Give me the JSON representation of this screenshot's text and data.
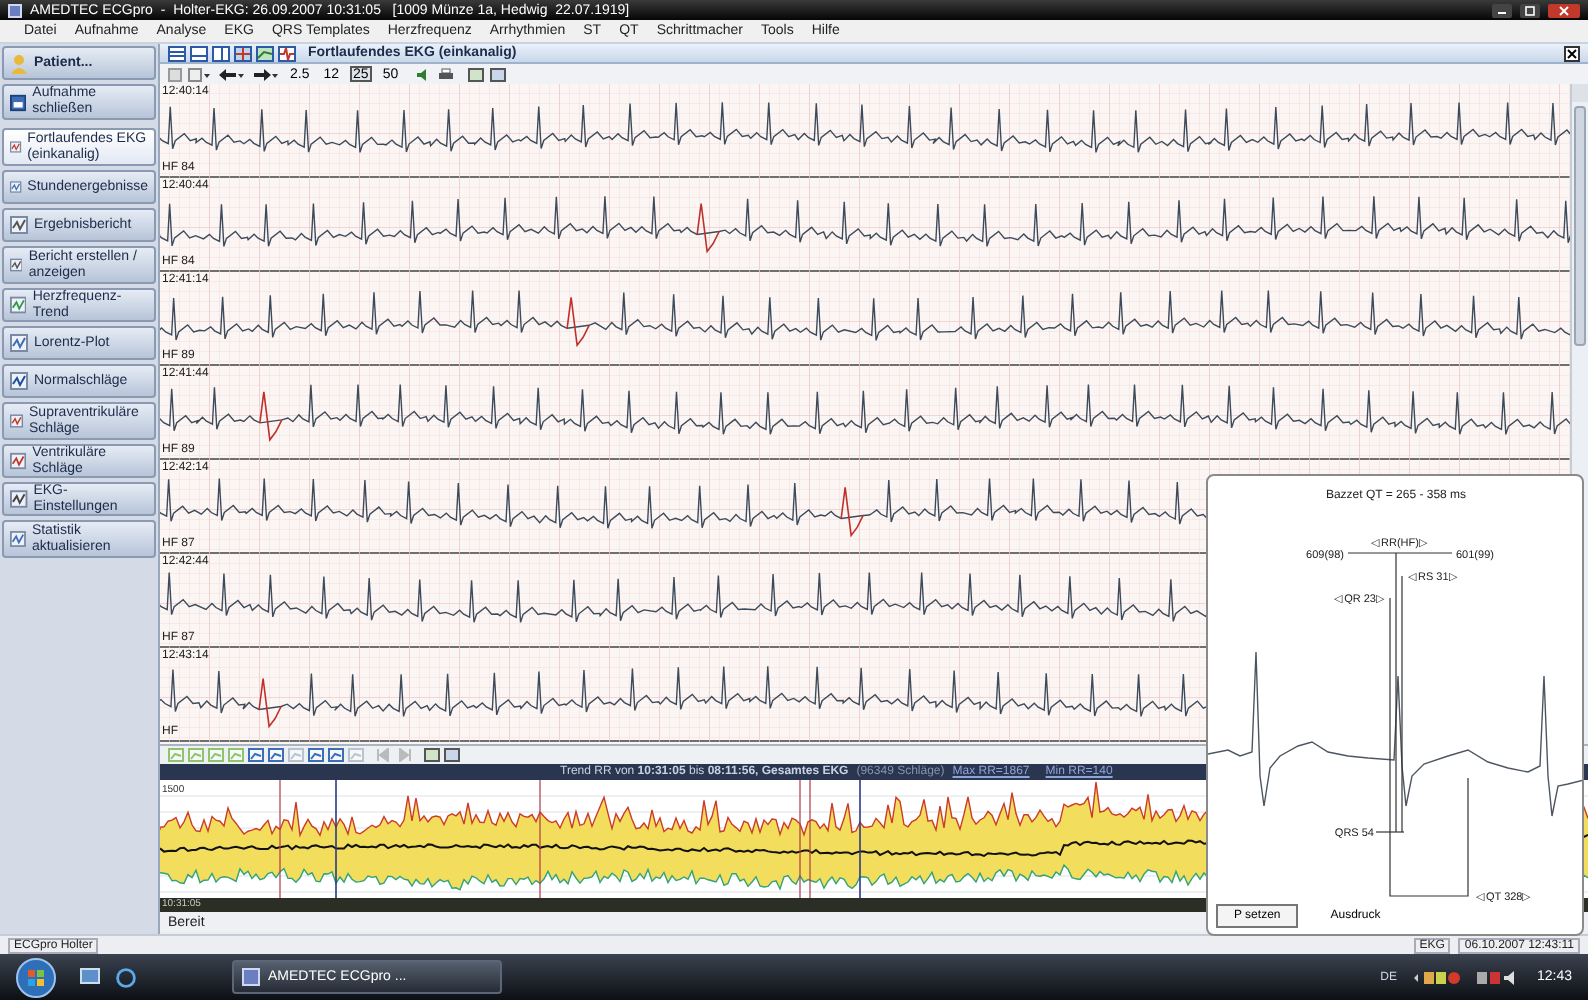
{
  "window": {
    "title": "AMEDTEC ECGpro  -  Holter-EKG: 26.09.2007 10:31:05   [1009 Münze 1a, Hedwig  22.07.1919]"
  },
  "menu": [
    "Datei",
    "Aufnahme",
    "Analyse",
    "EKG",
    "QRS Templates",
    "Herzfrequenz",
    "Arrhythmien",
    "ST",
    "QT",
    "Schrittmacher",
    "Tools",
    "Hilfe"
  ],
  "sidebar": {
    "patient_button": "Patient...",
    "close_button": "Aufnahme schließen",
    "items": [
      {
        "label": "Fortlaufendes EKG (einkanalig)",
        "selected": true
      },
      {
        "label": "Stundenergebnisse",
        "selected": false
      },
      {
        "label": "Ergebnisbericht",
        "selected": false
      },
      {
        "label": "Bericht erstellen / anzeigen",
        "selected": false
      },
      {
        "label": "Herzfrequenz-Trend",
        "selected": false
      },
      {
        "label": "Lorentz-Plot",
        "selected": false
      },
      {
        "label": "Normalschläge",
        "selected": false
      },
      {
        "label": "Supraventrikuläre Schläge",
        "selected": false
      },
      {
        "label": "Ventrikuläre Schläge",
        "selected": false
      },
      {
        "label": "EKG-Einstellungen",
        "selected": false
      },
      {
        "label": "Statistik aktualisieren",
        "selected": false
      }
    ]
  },
  "panel": {
    "title": "Fortlaufendes EKG (einkanalig)"
  },
  "speed_buttons": [
    {
      "label": "2.5",
      "selected": false
    },
    {
      "label": "12",
      "selected": false
    },
    {
      "label": "25",
      "selected": true
    },
    {
      "label": "50",
      "selected": false
    }
  ],
  "strips": [
    {
      "time": "12:40:14",
      "hf": "HF 84"
    },
    {
      "time": "12:40:44",
      "hf": "HF 84"
    },
    {
      "time": "12:41:14",
      "hf": "HF 89"
    },
    {
      "time": "12:41:44",
      "hf": "HF 89"
    },
    {
      "time": "12:42:14",
      "hf": "HF 87"
    },
    {
      "time": "12:42:44",
      "hf": "HF 87"
    },
    {
      "time": "12:43:14",
      "hf": "HF"
    }
  ],
  "trend": {
    "header": "Trend RR von **10:31:05** bis **08:11:56, Gesamtes EKG**",
    "count": "(96349 Schläge)",
    "max_link": "Max RR=1867",
    "min_link": "Min RR=140",
    "y_label": "1500",
    "start_time": "10:31:05"
  },
  "qt_panel": {
    "title": "Bazzet QT = 265 - 358 ms",
    "rr_label": "◁RR(HF)▷",
    "rr_left": "609(98)",
    "rr_right": "601(99)",
    "rs_label": "◁RS 31▷",
    "qr_label": "◁QR 23▷",
    "qrs_label": "QRS 54",
    "qt_label": "◁QT 328▷",
    "buttons": [
      "P setzen",
      "Ausdruck"
    ]
  },
  "status": "Bereit",
  "status_bar": {
    "app": "ECGpro Holter",
    "mode": "EKG",
    "datetime": "06.10.2007 12:43:11"
  },
  "taskbar": {
    "task": "AMEDTEC ECGpro ...",
    "language": "DE",
    "clock": "12:43"
  }
}
